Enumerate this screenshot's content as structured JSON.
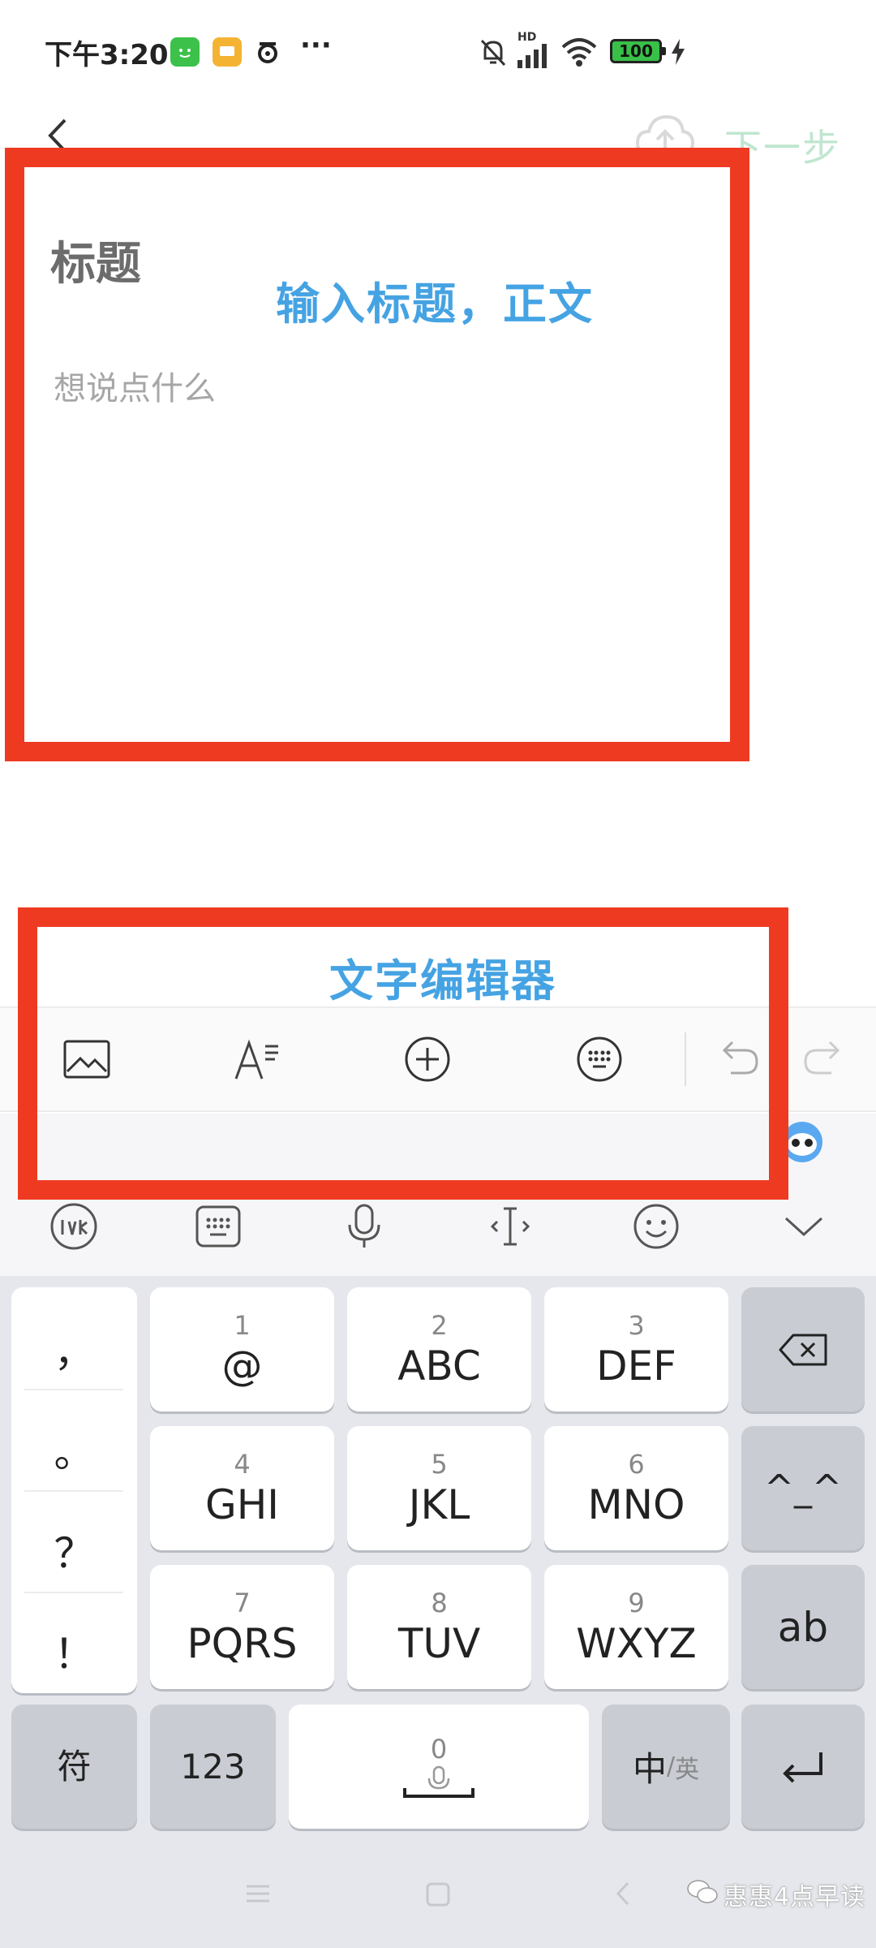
{
  "status_bar": {
    "time": "下午3:20",
    "more": "···",
    "network_label": "HD",
    "battery": "100"
  },
  "header": {
    "next_label": "下一步"
  },
  "editor": {
    "title_placeholder": "标题",
    "body_placeholder": "想说点什么"
  },
  "annotations": {
    "editor_label": "输入标题，正文",
    "toolbar_label": "文字编辑器"
  },
  "keyboard": {
    "punctuation": [
      "，",
      "。",
      "？",
      "！"
    ],
    "keys": [
      {
        "num": "1",
        "label": "@"
      },
      {
        "num": "2",
        "label": "ABC"
      },
      {
        "num": "3",
        "label": "DEF"
      },
      {
        "num": "4",
        "label": "GHI"
      },
      {
        "num": "5",
        "label": "JKL"
      },
      {
        "num": "6",
        "label": "MNO"
      },
      {
        "num": "7",
        "label": "PQRS"
      },
      {
        "num": "8",
        "label": "TUV"
      },
      {
        "num": "9",
        "label": "WXYZ"
      }
    ],
    "emoticon_key": "^_^",
    "ab_key": "ab",
    "symbol_key": "符",
    "numbers_key": "123",
    "space_num": "0",
    "lang_main": "中",
    "lang_sep": "/",
    "lang_alt": "英"
  },
  "watermark": "惠惠4点早读",
  "colors": {
    "annotation_border": "#ef3a22",
    "annotation_text": "#45a3e3",
    "next_button": "#bfe6cf",
    "battery": "#39c048"
  }
}
